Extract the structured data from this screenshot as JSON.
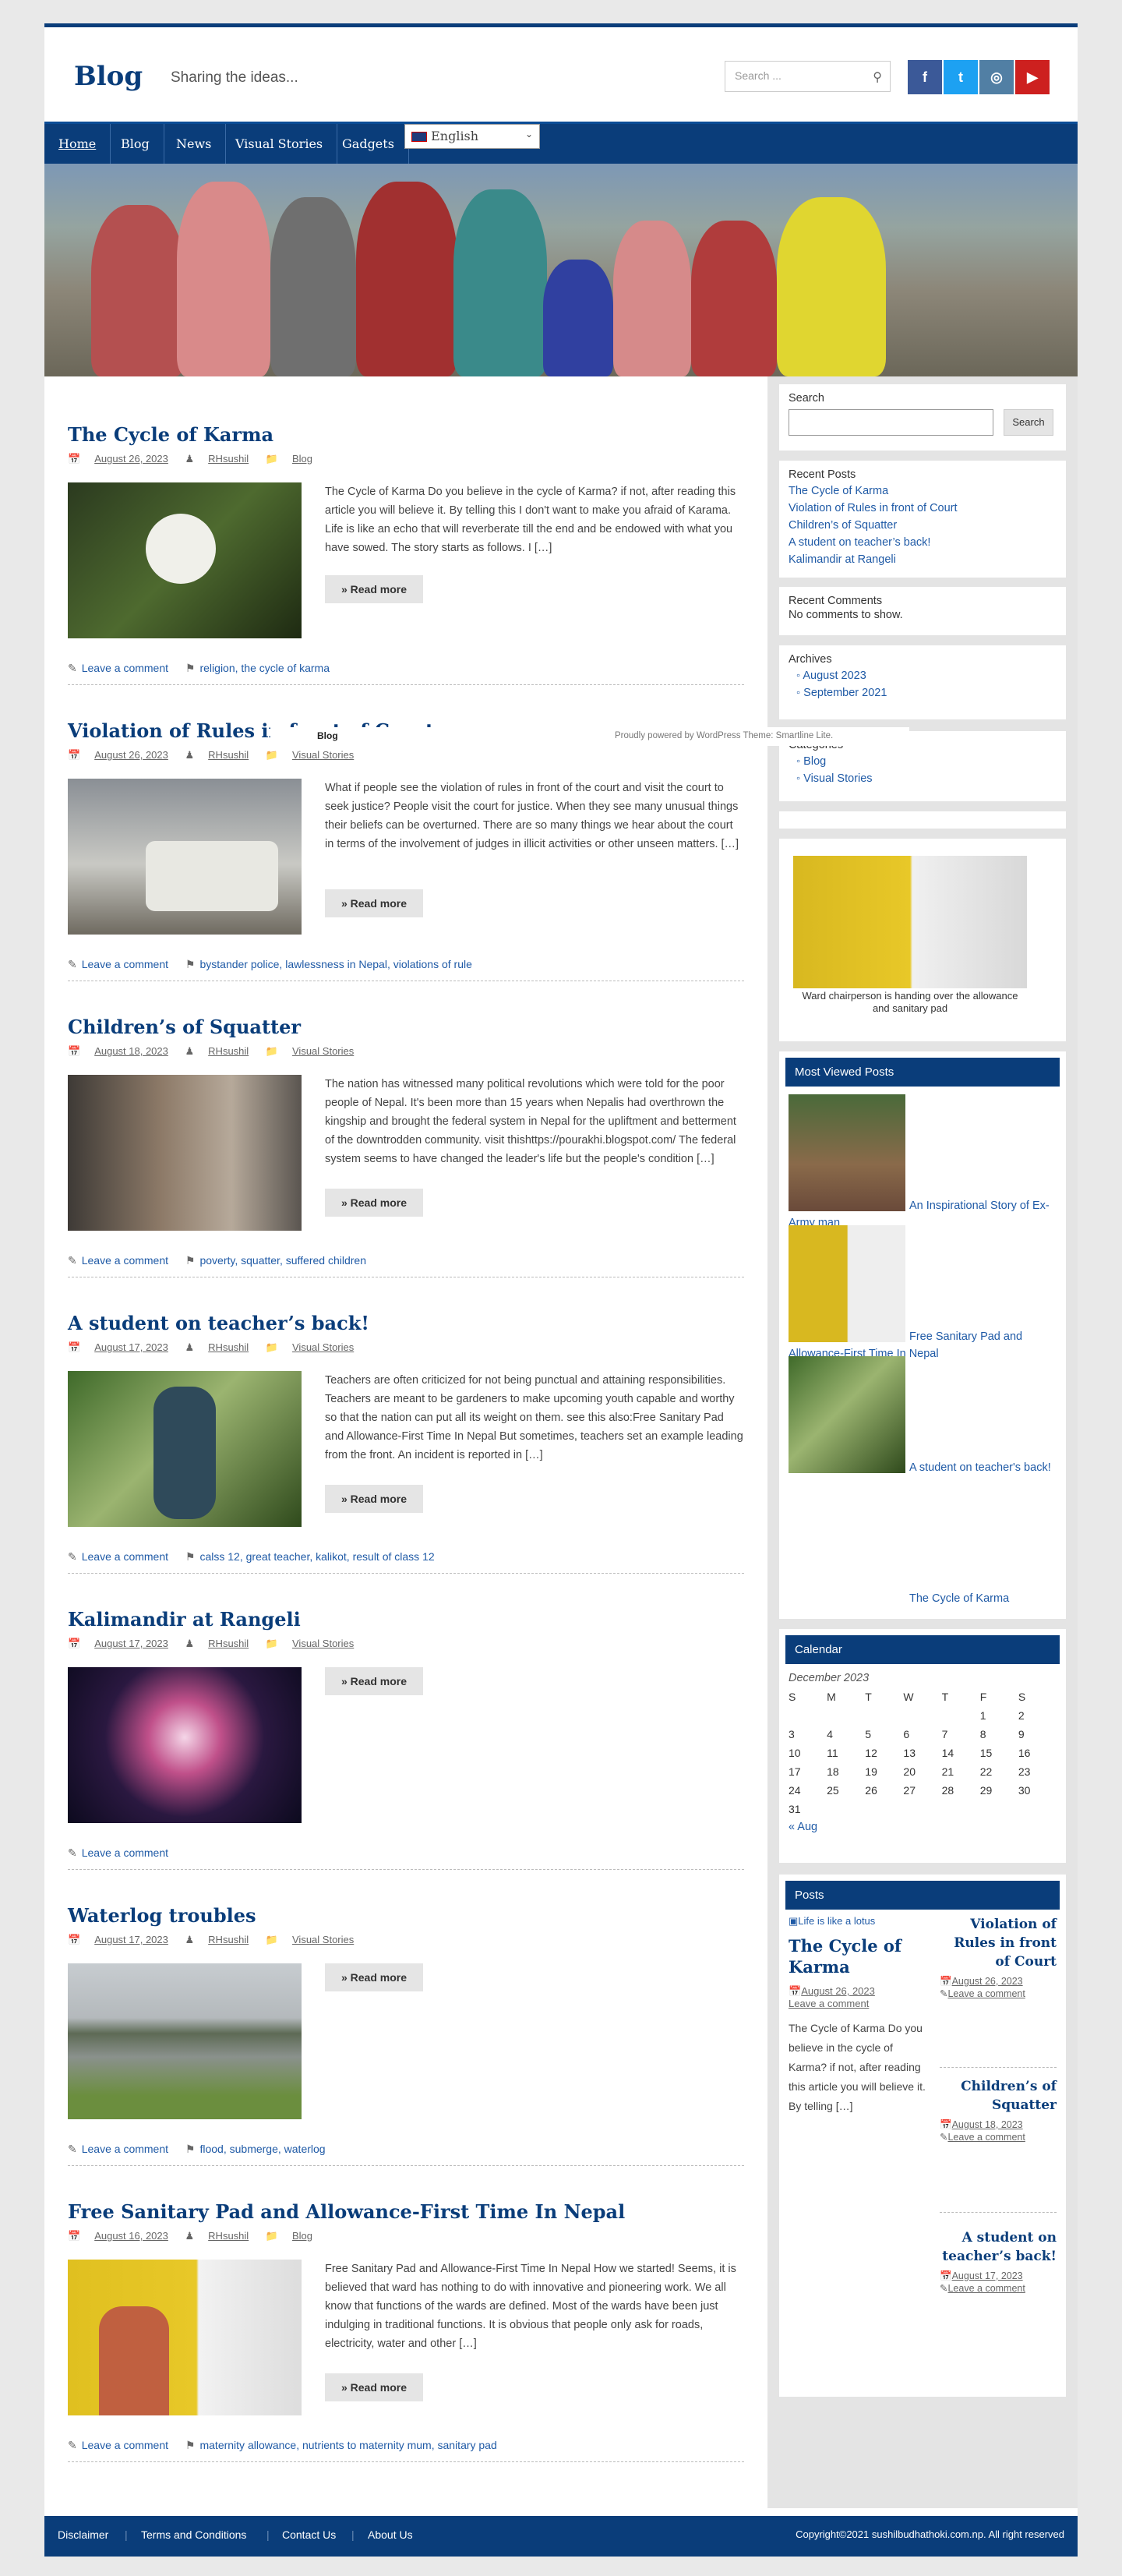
{
  "header": {
    "logo": "Blog",
    "tagline": "Sharing the ideas...",
    "search_placeholder": "Search ..."
  },
  "social": [
    "f",
    "t",
    "◎",
    "▶"
  ],
  "nav": {
    "items": [
      "Home",
      "Blog",
      "News",
      "Visual Stories",
      "Gadgets"
    ],
    "language": "English"
  },
  "tooltip": {
    "label": "Blog",
    "powered": "Proudly powered by WordPress Theme: Smartline Lite."
  },
  "posts": [
    {
      "title": "The Cycle of Karma",
      "date": "August 26, 2023",
      "author": "RHsushil",
      "category": "Blog",
      "excerpt": "The Cycle of Karma   Do you believe in the cycle of Karma? if not, after reading this article you will believe it. By telling this I don't want to make you afraid of Karama. Life is like an echo that will reverberate till the end and be endowed with what you have sowed. The story starts as follows. I […]",
      "read_more": "» Read more",
      "comment": "Leave a comment",
      "tags": "religion, the cycle of karma"
    },
    {
      "title": "Violation of Rules in front of Court",
      "date": "August 26, 2023",
      "author": "RHsushil",
      "category": "Visual Stories",
      "excerpt": "What if people see the violation of rules in front of the court and visit the court to seek justice?    People visit the court for justice. When they see many unusual things their beliefs can be overturned. There are so many things we hear about the court in terms of the involvement of judges in illicit activities or other unseen matters. […]",
      "read_more": "» Read more",
      "comment": "Leave a comment",
      "tags": "bystander police, lawlessness in Nepal, violations of rule"
    },
    {
      "title": "Children’s of Squatter",
      "date": "August 18, 2023",
      "author": "RHsushil",
      "category": "Visual Stories",
      "excerpt": "The nation has witnessed many political revolutions which were told for the poor people of Nepal. It's been more than 15 years when Nepalis had overthrown the kingship and brought the federal system in Nepal for the upliftment and betterment of the downtrodden community. visit thishttps://pourakhi.blogspot.com/ The federal system seems to have changed the leader's life but the people's condition […]",
      "read_more": "» Read more",
      "comment": "Leave a comment",
      "tags": "poverty, squatter, suffered children"
    },
    {
      "title": "A student on teacher’s back!",
      "date": "August 17, 2023",
      "author": "RHsushil",
      "category": "Visual Stories",
      "excerpt": "Teachers are often criticized for not being punctual and attaining responsibilities. Teachers are meant to be gardeners to make upcoming youth capable and worthy so that the nation can put all its weight on them. see this also:Free Sanitary Pad and Allowance-First Time In Nepal But sometimes, teachers set an example leading from the front. An incident is reported in […]",
      "read_more": "» Read more",
      "comment": "Leave a comment",
      "tags": "calss 12, great teacher, kalikot, result of class 12"
    },
    {
      "title": "Kalimandir at Rangeli",
      "date": "August 17, 2023",
      "author": "RHsushil",
      "category": "Visual Stories",
      "excerpt": "",
      "read_more": "» Read more",
      "comment": "Leave a comment",
      "tags": ""
    },
    {
      "title": "Waterlog troubles",
      "date": "August 17, 2023",
      "author": "RHsushil",
      "category": "Visual Stories",
      "excerpt": "",
      "read_more": "» Read more",
      "comment": "Leave a comment",
      "tags": "flood, submerge, waterlog"
    },
    {
      "title": "Free Sanitary Pad and Allowance-First Time In Nepal",
      "date": "August 16, 2023",
      "author": "RHsushil",
      "category": "Blog",
      "excerpt": "Free Sanitary Pad and Allowance-First Time In Nepal How we started! Seems, it is believed that ward has nothing to do with innovative and pioneering work. We all know that functions of the wards are defined. Most of the wards have been just indulging in traditional functions.  It is obvious that people only ask for roads, electricity, water and other […]",
      "read_more": "» Read more",
      "comment": "Leave a comment",
      "tags": "maternity allowance, nutrients to maternity mum, sanitary pad"
    }
  ],
  "sidebar": {
    "search": {
      "title": "Search",
      "button": "Search"
    },
    "recent_posts": {
      "title": "Recent Posts",
      "items": [
        "The Cycle of Karma",
        "Violation of Rules in front of Court",
        "Children’s of Squatter",
        "A student on teacher’s back!",
        "Kalimandir at Rangeli"
      ]
    },
    "recent_comments": {
      "title": "Recent Comments",
      "text": "No comments to show."
    },
    "archives": {
      "title": "Archives",
      "items": [
        "August 2023",
        "September 2021"
      ]
    },
    "categories": {
      "title": "Categories",
      "items": [
        "Blog",
        "Visual Stories"
      ]
    },
    "image_caption": "Ward chairperson is handing over the allowance and sanitary pad",
    "most_viewed": {
      "title": "Most Viewed Posts",
      "items": [
        "An Inspirational Story of Ex-Army man",
        "Free Sanitary Pad and Allowance-First Time In Nepal",
        "A student on teacher's back!",
        "The Cycle of Karma"
      ]
    },
    "calendar": {
      "title": "Calendar",
      "month": "December 2023",
      "days": [
        "S",
        "M",
        "T",
        "W",
        "T",
        "F",
        "S"
      ],
      "weeks": [
        [
          "",
          "",
          "",
          "",
          "",
          "1",
          "2"
        ],
        [
          "3",
          "4",
          "5",
          "6",
          "7",
          "8",
          "9"
        ],
        [
          "10",
          "11",
          "12",
          "13",
          "14",
          "15",
          "16"
        ],
        [
          "17",
          "18",
          "19",
          "20",
          "21",
          "22",
          "23"
        ],
        [
          "24",
          "25",
          "26",
          "27",
          "28",
          "29",
          "30"
        ],
        [
          "31",
          "",
          "",
          "",
          "",
          "",
          ""
        ]
      ],
      "prev": "« Aug"
    },
    "posts_widget": {
      "title": "Posts",
      "image_alt": "Life is like a lotus",
      "main_title": "The Cycle of Karma",
      "main_date": "August 26, 2023",
      "main_comment": "Leave a comment",
      "main_excerpt": "The Cycle of Karma Do you believe in the cycle of Karma? if not, after reading this article you will believe it. By telling […]",
      "side": [
        {
          "title": "Violation of Rules in front of Court",
          "date": "August 26, 2023",
          "comment": "Leave a comment"
        },
        {
          "title": "Children’s of Squatter",
          "date": "August 18, 2023",
          "comment": "Leave a comment"
        },
        {
          "title": "A student on teacher’s back!",
          "date": "August 17, 2023",
          "comment": "Leave a comment"
        }
      ]
    }
  },
  "footer": {
    "links": [
      "Disclaimer",
      "Terms and Conditions",
      "Contact Us",
      "About Us"
    ],
    "copyright": "Copyright©2021 sushilbudhathoki.com.np. All right reserved"
  }
}
